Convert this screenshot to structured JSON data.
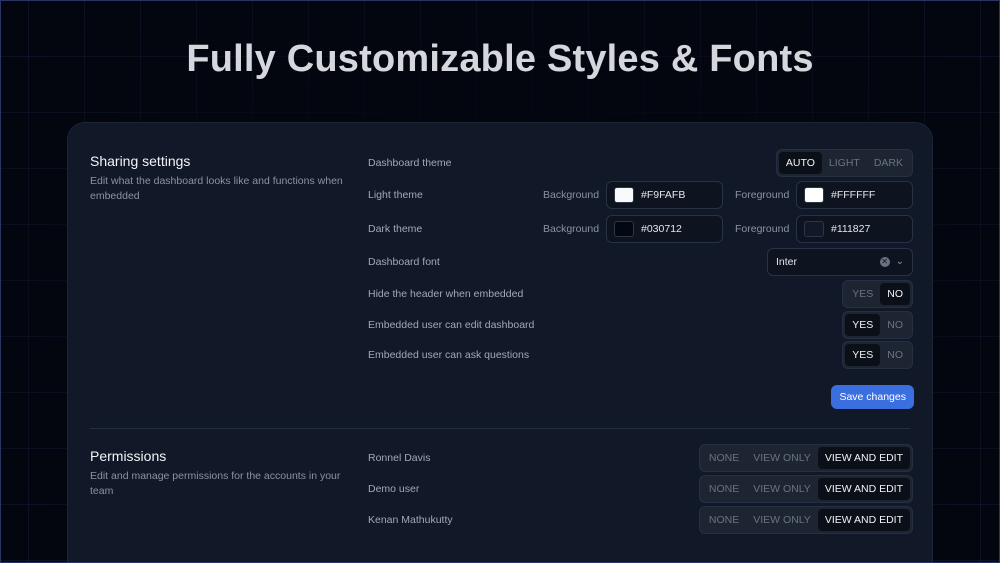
{
  "hero": {
    "title": "Fully Customizable Styles & Fonts"
  },
  "sharing": {
    "title": "Sharing settings",
    "description": "Edit what the dashboard looks like and functions when embedded",
    "theme": {
      "label": "Dashboard theme",
      "options": [
        "AUTO",
        "LIGHT",
        "DARK"
      ],
      "selected": "AUTO"
    },
    "light_theme": {
      "label": "Light theme",
      "bg_label": "Background",
      "bg_value": "#F9FAFB",
      "bg_color": "#F9FAFB",
      "fg_label": "Foreground",
      "fg_value": "#FFFFFF",
      "fg_color": "#FFFFFF"
    },
    "dark_theme": {
      "label": "Dark theme",
      "bg_label": "Background",
      "bg_value": "#030712",
      "bg_color": "#030712",
      "fg_label": "Foreground",
      "fg_value": "#111827",
      "fg_color": "#111827"
    },
    "font": {
      "label": "Dashboard font",
      "value": "Inter"
    },
    "hide_header": {
      "label": "Hide the header when embedded",
      "yes": "YES",
      "no": "NO",
      "selected": "NO"
    },
    "can_edit": {
      "label": "Embedded user can edit dashboard",
      "yes": "YES",
      "no": "NO",
      "selected": "YES"
    },
    "can_ask": {
      "label": "Embedded user can ask questions",
      "yes": "YES",
      "no": "NO",
      "selected": "YES"
    },
    "save_label": "Save changes"
  },
  "permissions": {
    "title": "Permissions",
    "description": "Edit and manage permissions for the accounts in your team",
    "levels": [
      "NONE",
      "VIEW ONLY",
      "VIEW AND EDIT"
    ],
    "users": [
      {
        "name": "Ronnel Davis",
        "selected": "VIEW AND EDIT"
      },
      {
        "name": "Demo user",
        "selected": "VIEW AND EDIT"
      },
      {
        "name": "Kenan Mathukutty",
        "selected": "VIEW AND EDIT"
      }
    ]
  },
  "colors": {
    "accent": "#3b6fe0",
    "card": "#111827",
    "background": "#03060f"
  }
}
